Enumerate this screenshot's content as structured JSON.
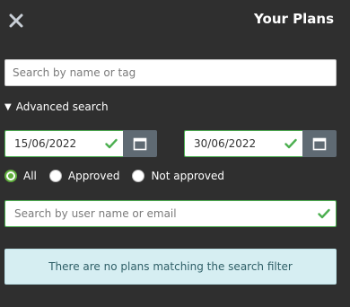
{
  "header": {
    "title": "Your Plans",
    "close_icon": "close-icon"
  },
  "search": {
    "placeholder": "Search by name or tag",
    "value": ""
  },
  "advanced": {
    "label": "Advanced search",
    "expanded": true
  },
  "dates": {
    "from": "15/06/2022",
    "to": "30/06/2022",
    "icons": [
      "check-icon",
      "calendar-icon"
    ]
  },
  "filter": {
    "options": [
      {
        "label": "All",
        "checked": true
      },
      {
        "label": "Approved",
        "checked": false
      },
      {
        "label": "Not approved",
        "checked": false
      }
    ]
  },
  "user_search": {
    "placeholder": "Search by user name or email",
    "value": ""
  },
  "notice": {
    "text": "There are no plans matching the search filter"
  },
  "colors": {
    "background": "#2f2f2f",
    "accent_green": "#4caf50",
    "calendar_button": "#5f6a73",
    "notice_bg": "#d6eef2",
    "notice_text": "#2f5f67"
  }
}
